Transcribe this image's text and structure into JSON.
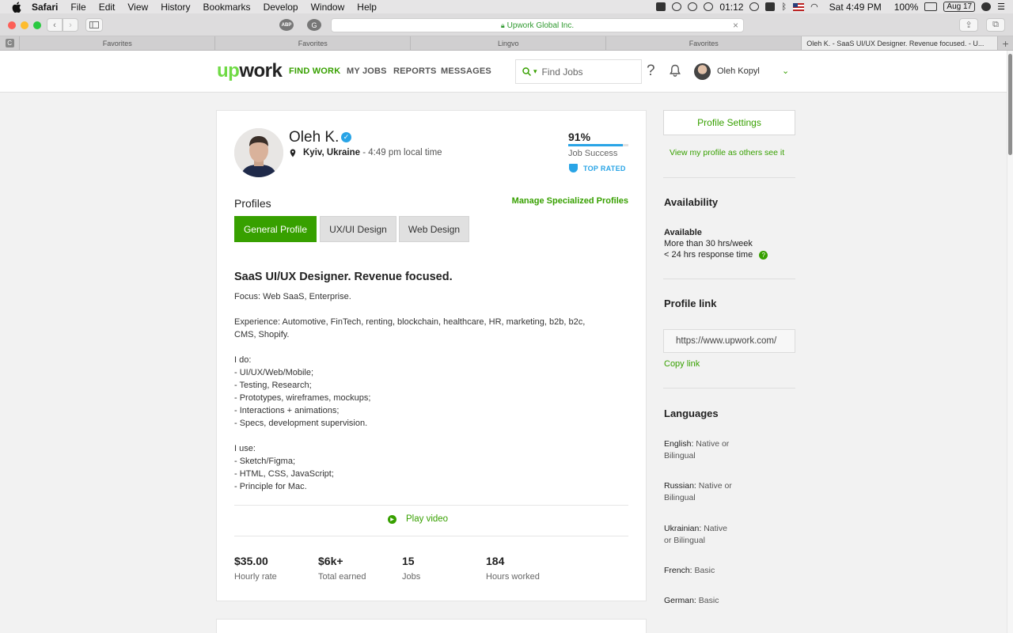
{
  "menubar": {
    "app": "Safari",
    "items": [
      "File",
      "Edit",
      "View",
      "History",
      "Bookmarks",
      "Develop",
      "Window",
      "Help"
    ],
    "clock": "01:12",
    "datetime": "Sat 4:49 PM",
    "battery": "100%",
    "date_badge": "Aug 17"
  },
  "browser": {
    "address": "Upwork Global Inc.",
    "ext_abp": "ABP",
    "ext_g": "G",
    "tab_pin_label": "C",
    "tabs": [
      "Favorites",
      "Favorites",
      "Lingvo",
      "Favorites",
      "Oleh K. - SaaS UI/UX Designer. Revenue focused. - U..."
    ]
  },
  "header": {
    "logo_up": "up",
    "logo_work": "work",
    "nav": [
      "FIND WORK",
      "MY JOBS",
      "REPORTS",
      "MESSAGES"
    ],
    "search_placeholder": "Find Jobs",
    "help": "?",
    "user_name": "Oleh Kopyl"
  },
  "profile": {
    "name": "Oleh K.",
    "city": "Kyiv, Ukraine",
    "time": "- 4:49 pm local time",
    "job_success_pct": "91%",
    "job_success_value": 0.91,
    "job_success_label": "Job Success",
    "top_rated": "TOP RATED",
    "profiles_title": "Profiles",
    "manage_link": "Manage Specialized Profiles",
    "tabs": [
      "General Profile",
      "UX/UI Design",
      "Web Design"
    ],
    "headline": "SaaS UI/UX Designer. Revenue focused.",
    "description": [
      "Focus: Web SaaS, Enterprise.",
      "",
      "Experience: Automotive, FinTech, renting, blockchain, healthcare, HR, marketing, b2b, b2c,",
      "CMS, Shopify.",
      "",
      "I do:",
      "- UI/UX/Web/Mobile;",
      "- Testing, Research;",
      "- Prototypes, wireframes, mockups;",
      "- Interactions + animations;",
      "- Specs, development supervision.",
      "",
      "I use:",
      "- Sketch/Figma;",
      "- HTML, CSS, JavaScript;",
      "- Principle for Mac."
    ],
    "play_video": "Play video",
    "stats": [
      {
        "value": "$35.00",
        "label": "Hourly rate"
      },
      {
        "value": "$6k+",
        "label": "Total earned"
      },
      {
        "value": "15",
        "label": "Jobs"
      },
      {
        "value": "184",
        "label": "Hours worked"
      }
    ]
  },
  "sidebar": {
    "settings_button": "Profile Settings",
    "view_as_others": "View my profile as others see it",
    "availability_title": "Availability",
    "availability_status": "Available",
    "availability_hours": "More than 30 hrs/week",
    "response_time": "< 24 hrs response time",
    "profile_link_title": "Profile link",
    "profile_url": "https://www.upwork.com/",
    "copy_link": "Copy link",
    "languages_title": "Languages",
    "languages": [
      {
        "name": "English:",
        "level_1": "Native or",
        "level_2": "Bilingual"
      },
      {
        "name": "Russian:",
        "level_1": "Native or",
        "level_2": "Bilingual"
      },
      {
        "name": "Ukrainian:",
        "level_1": "Native",
        "level_2": "or Bilingual"
      },
      {
        "name": "French:",
        "level_1": "Basic",
        "level_2": ""
      },
      {
        "name": "German:",
        "level_1": "Basic",
        "level_2": ""
      }
    ]
  },
  "colors": {
    "brand_green": "#37a000",
    "logo_green": "#6fda44",
    "accent_blue": "#29a4e6"
  }
}
